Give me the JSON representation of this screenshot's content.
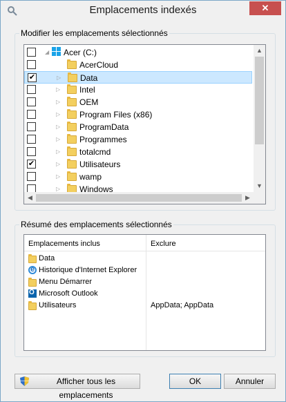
{
  "window": {
    "title": "Emplacements indexés",
    "close_symbol": "✕"
  },
  "modify_group": {
    "label": "Modifier les emplacements sélectionnés",
    "tree": [
      {
        "label": "Acer (C:)",
        "checked": false,
        "expanded": true,
        "icon": "drive-icon",
        "level": 0
      },
      {
        "label": "AcerCloud",
        "checked": false,
        "expanded": false,
        "has_children": false,
        "icon": "folder-icon",
        "level": 1
      },
      {
        "label": "Data",
        "checked": true,
        "expanded": false,
        "has_children": true,
        "icon": "folder-icon",
        "level": 1,
        "selected": true
      },
      {
        "label": "Intel",
        "checked": false,
        "expanded": false,
        "has_children": true,
        "icon": "folder-icon",
        "level": 1
      },
      {
        "label": "OEM",
        "checked": false,
        "expanded": false,
        "has_children": true,
        "icon": "folder-icon",
        "level": 1
      },
      {
        "label": "Program Files (x86)",
        "checked": false,
        "expanded": false,
        "has_children": true,
        "icon": "folder-icon",
        "level": 1
      },
      {
        "label": "ProgramData",
        "checked": false,
        "expanded": false,
        "has_children": true,
        "icon": "folder-icon",
        "level": 1
      },
      {
        "label": "Programmes",
        "checked": false,
        "expanded": false,
        "has_children": true,
        "icon": "folder-icon",
        "level": 1
      },
      {
        "label": "totalcmd",
        "checked": false,
        "expanded": false,
        "has_children": true,
        "icon": "folder-icon",
        "level": 1
      },
      {
        "label": "Utilisateurs",
        "checked": true,
        "expanded": false,
        "has_children": true,
        "icon": "folder-icon",
        "level": 1
      },
      {
        "label": "wamp",
        "checked": false,
        "expanded": false,
        "has_children": true,
        "icon": "folder-icon",
        "level": 1
      },
      {
        "label": "Windows",
        "checked": false,
        "expanded": false,
        "has_children": true,
        "icon": "folder-icon",
        "level": 1
      }
    ]
  },
  "summary_group": {
    "label": "Résumé des emplacements sélectionnés",
    "columns": [
      "Emplacements inclus",
      "Exclure"
    ],
    "rows": [
      {
        "name": "Data",
        "icon": "folder-icon",
        "exclude": ""
      },
      {
        "name": "Historique d'Internet Explorer",
        "icon": "internet-explorer-icon",
        "exclude": ""
      },
      {
        "name": "Menu Démarrer",
        "icon": "folder-icon",
        "exclude": ""
      },
      {
        "name": "Microsoft Outlook",
        "icon": "outlook-icon",
        "exclude": ""
      },
      {
        "name": "Utilisateurs",
        "icon": "folder-icon",
        "exclude": "AppData; AppData"
      }
    ]
  },
  "buttons": {
    "show_all": "Afficher tous les emplacements",
    "ok": "OK",
    "cancel": "Annuler"
  },
  "colors": {
    "selection": "#cce8ff",
    "close_button": "#c7504f",
    "folder": "#f3cf5f"
  }
}
